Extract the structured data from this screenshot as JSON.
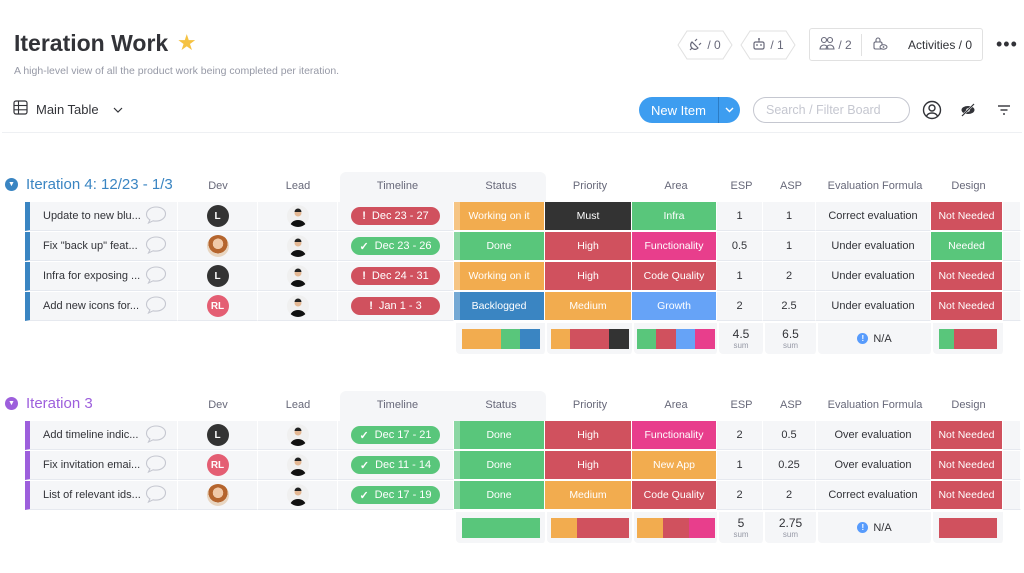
{
  "header": {
    "title": "Iteration Work",
    "subtitle": "A high-level view of all the product work being completed per iteration.",
    "integrations_count": "/ 0",
    "automations_count": "/ 1",
    "members_count": "/ 2",
    "activities_label": "Activities / 0"
  },
  "toolbar": {
    "view_label": "Main Table",
    "new_item_label": "New Item",
    "search_placeholder": "Search / Filter Board"
  },
  "columns": {
    "dev": "Dev",
    "lead": "Lead",
    "timeline": "Timeline",
    "status": "Status",
    "priority": "Priority",
    "area": "Area",
    "esp": "ESP",
    "asp": "ASP",
    "evaluation": "Evaluation Formula",
    "design": "Design"
  },
  "colors": {
    "working": "#f2ac4f",
    "done": "#59c67b",
    "backlogged": "#3a85c2",
    "must": "#333333",
    "high": "#d0515e",
    "medium": "#f2ac4f",
    "infra": "#59c67b",
    "functionality": "#e83e8c",
    "code_quality": "#d0515e",
    "growth": "#66a3f7",
    "new_app": "#f2ac4f",
    "not_needed": "#d0515e",
    "needed": "#59c67b",
    "group4": "#3a85c2",
    "group3": "#9d5fdc"
  },
  "groups": [
    {
      "title": "Iteration 4: 12/23 - 1/3",
      "rows": [
        {
          "name": "Update to new blu...",
          "dev": "L",
          "timeline": "Dec 23 - 27",
          "timeline_state": "overdue",
          "status": "Working on it",
          "priority": "Must",
          "area": "Infra",
          "esp": "1",
          "asp": "1",
          "evaluation": "Correct evaluation",
          "design": "Not Needed"
        },
        {
          "name": "Fix \"back up\" feat...",
          "dev": "photo",
          "timeline": "Dec 23 - 26",
          "timeline_state": "done",
          "status": "Done",
          "priority": "High",
          "area": "Functionality",
          "esp": "0.5",
          "asp": "1",
          "evaluation": "Under evaluation",
          "design": "Needed"
        },
        {
          "name": "Infra for exposing ...",
          "dev": "L",
          "timeline": "Dec 24 - 31",
          "timeline_state": "overdue",
          "status": "Working on it",
          "priority": "High",
          "area": "Code Quality",
          "esp": "1",
          "asp": "2",
          "evaluation": "Under evaluation",
          "design": "Not Needed"
        },
        {
          "name": "Add new icons for...",
          "dev": "RL",
          "timeline": "Jan 1 - 3",
          "timeline_state": "overdue",
          "status": "Backlogged",
          "priority": "Medium",
          "area": "Growth",
          "esp": "2",
          "asp": "2.5",
          "evaluation": "Under evaluation",
          "design": "Not Needed"
        }
      ],
      "summary": {
        "esp_sum": "4.5",
        "asp_sum": "6.5",
        "sum_label": "sum",
        "evaluation": "N/A"
      }
    },
    {
      "title": "Iteration 3",
      "rows": [
        {
          "name": "Add timeline indic...",
          "dev": "L",
          "timeline": "Dec 17 - 21",
          "timeline_state": "done",
          "status": "Done",
          "priority": "High",
          "area": "Functionality",
          "esp": "2",
          "asp": "0.5",
          "evaluation": "Over evaluation",
          "design": "Not Needed"
        },
        {
          "name": "Fix invitation emai...",
          "dev": "RL",
          "timeline": "Dec 11 - 14",
          "timeline_state": "done",
          "status": "Done",
          "priority": "High",
          "area": "New App",
          "esp": "1",
          "asp": "0.25",
          "evaluation": "Over evaluation",
          "design": "Not Needed"
        },
        {
          "name": "List of relevant ids...",
          "dev": "photo",
          "timeline": "Dec 17 - 19",
          "timeline_state": "done",
          "status": "Done",
          "priority": "Medium",
          "area": "Code Quality",
          "esp": "2",
          "asp": "2",
          "evaluation": "Correct evaluation",
          "design": "Not Needed"
        }
      ],
      "summary": {
        "esp_sum": "5",
        "asp_sum": "2.75",
        "sum_label": "sum",
        "evaluation": "N/A"
      }
    }
  ]
}
